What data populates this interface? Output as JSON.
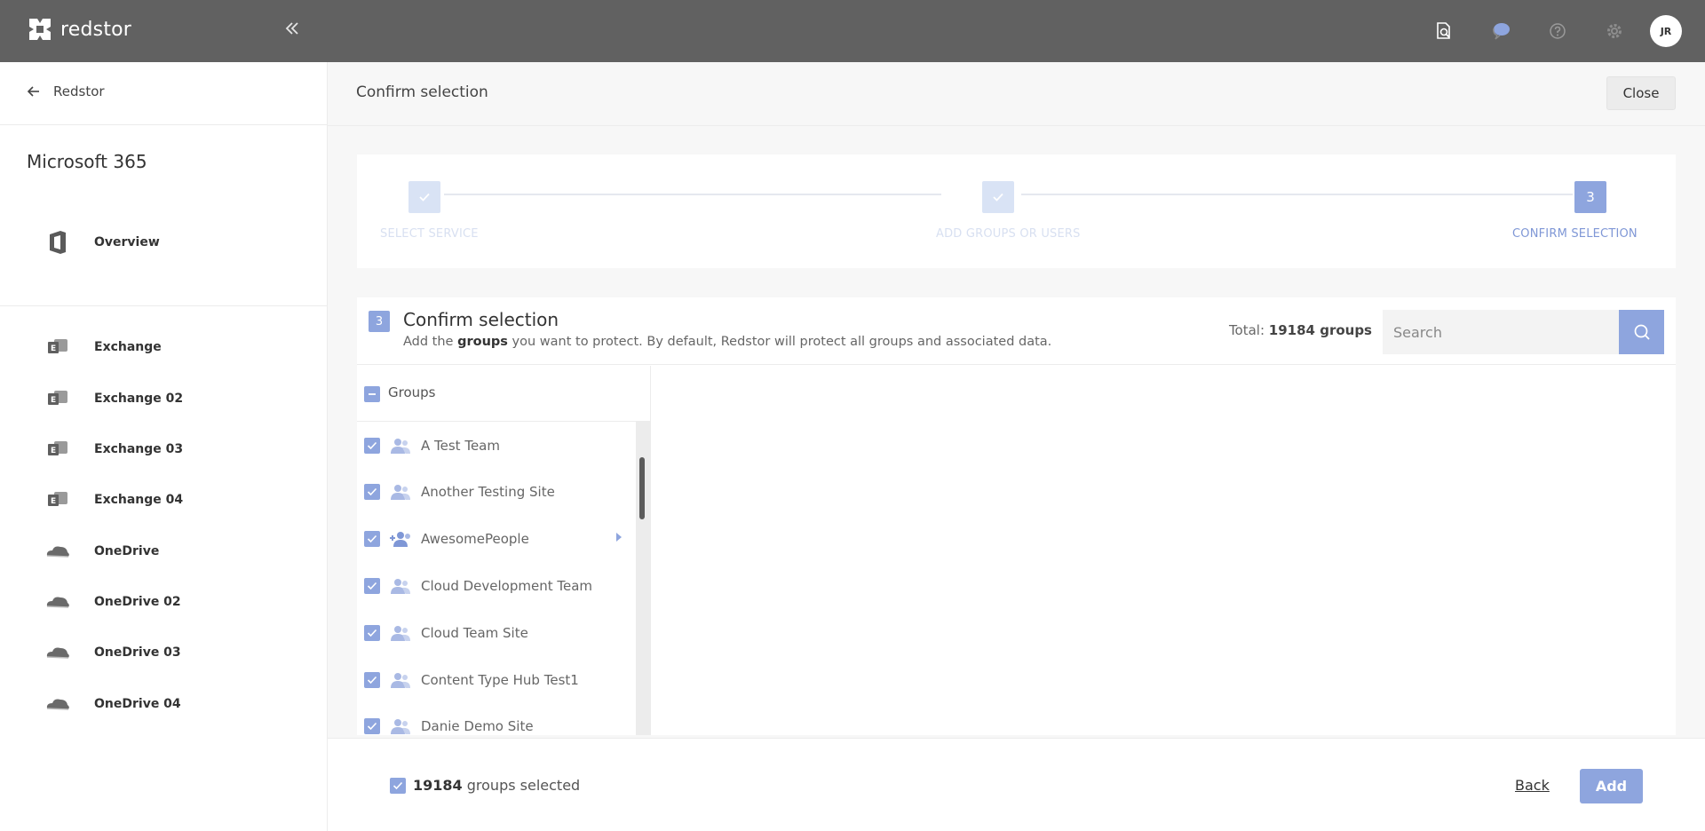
{
  "header": {
    "brand": "redstor",
    "collapse_icon": "double-chevron-left-icon",
    "icons": [
      "search-document-icon",
      "chat-bubble-icon",
      "help-icon",
      "gear-icon"
    ],
    "avatar_initials": "JR"
  },
  "sidebar": {
    "back_label": "Redstor",
    "product_title": "Microsoft 365",
    "items": [
      {
        "label": "Overview",
        "icon": "office-icon"
      },
      {
        "label": "Exchange",
        "icon": "exchange-icon"
      },
      {
        "label": "Exchange 02",
        "icon": "exchange-icon"
      },
      {
        "label": "Exchange 03",
        "icon": "exchange-icon"
      },
      {
        "label": "Exchange 04",
        "icon": "exchange-icon"
      },
      {
        "label": "OneDrive",
        "icon": "onedrive-icon"
      },
      {
        "label": "OneDrive 02",
        "icon": "onedrive-icon"
      },
      {
        "label": "OneDrive 03",
        "icon": "onedrive-icon"
      },
      {
        "label": "OneDrive 04",
        "icon": "onedrive-icon"
      }
    ]
  },
  "page": {
    "title": "Confirm selection",
    "close_label": "Close"
  },
  "stepper": {
    "steps": [
      {
        "label": "SELECT SERVICE",
        "state": "done"
      },
      {
        "label": "ADD GROUPS OR USERS",
        "state": "done"
      },
      {
        "label": "CONFIRM SELECTION",
        "state": "active",
        "number": "3"
      }
    ]
  },
  "card": {
    "step_number": "3",
    "title": "Confirm selection",
    "subtitle_pre": "Add the ",
    "subtitle_bold": "groups",
    "subtitle_post": " you want to protect. By default, Redstor will protect all groups and associated data.",
    "total_prefix": "Total: ",
    "total_value": "19184 groups",
    "search_placeholder": "Search"
  },
  "tree": {
    "header_label": "Groups",
    "items": [
      {
        "label": "A Test Team",
        "expandable": false
      },
      {
        "label": "Another Testing Site",
        "expandable": false
      },
      {
        "label": "AwesomePeople",
        "expandable": true
      },
      {
        "label": "Cloud Development Team",
        "expandable": false
      },
      {
        "label": "Cloud Team Site",
        "expandable": false
      },
      {
        "label": "Content Type Hub Test1",
        "expandable": false
      },
      {
        "label": "Danie Demo Site",
        "expandable": false
      }
    ]
  },
  "footer": {
    "count": "19184",
    "count_suffix": " groups selected",
    "back_label": "Back",
    "add_label": "Add"
  },
  "colors": {
    "accent": "#8ea5de",
    "topbar": "#616161"
  }
}
